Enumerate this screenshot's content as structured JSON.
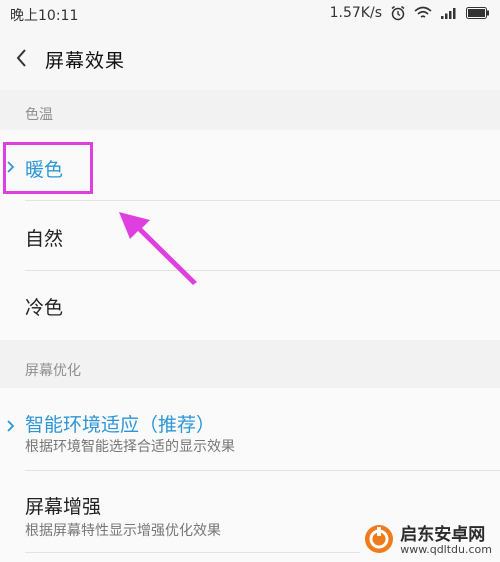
{
  "status_bar": {
    "time": "晚上10:11",
    "speed": "1.57K/s",
    "icons": [
      "alarm-icon",
      "wifi-icon",
      "signal-icon",
      "battery-icon"
    ]
  },
  "header": {
    "title": "屏幕效果",
    "back_icon": "chevron-left-icon"
  },
  "color_temp": {
    "section_label": "色温",
    "options": [
      {
        "label": "暖色",
        "selected": true
      },
      {
        "label": "自然",
        "selected": false
      },
      {
        "label": "冷色",
        "selected": false
      }
    ]
  },
  "optimization": {
    "section_label": "屏幕优化",
    "options": [
      {
        "label": "智能环境适应（推荐）",
        "description": "根据环境智能选择合适的显示效果",
        "selected": true
      },
      {
        "label": "屏幕增强",
        "description": "根据屏幕特性显示增强优化效果",
        "selected": false
      }
    ]
  },
  "annotation": {
    "color": "#e03fe0"
  },
  "watermark": {
    "name": "启东安卓网",
    "url": "www.qdltdu.com"
  },
  "colors": {
    "accent": "#2c96d6",
    "annotation": "#e03fe0"
  }
}
